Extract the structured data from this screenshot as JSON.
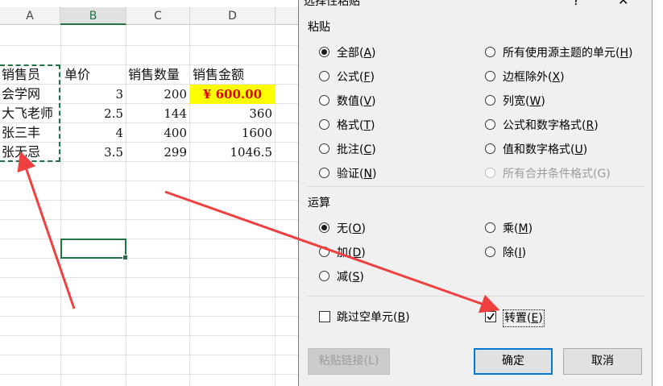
{
  "sheet": {
    "columns": [
      "A",
      "B",
      "C",
      "D"
    ],
    "selected_column": "B",
    "headers": [
      "销售员",
      "单价",
      "销售数量",
      "销售金额"
    ],
    "rows": [
      {
        "name": "会学网",
        "price": "3",
        "qty": "200",
        "amount": "¥ 600.00"
      },
      {
        "name": "大飞老师",
        "price": "2.5",
        "qty": "144",
        "amount": "360"
      },
      {
        "name": "张三丰",
        "price": "4",
        "qty": "400",
        "amount": "1600"
      },
      {
        "name": "张无忌",
        "price": "3.5",
        "qty": "299",
        "amount": "1046.5"
      }
    ]
  },
  "dialog": {
    "title": "选择性粘贴",
    "close_glyph": "✕",
    "min_glyph": "?",
    "paste_group": "粘贴",
    "paste_options_left": [
      {
        "label": "全部",
        "key": "A",
        "checked": true
      },
      {
        "label": "公式",
        "key": "F"
      },
      {
        "label": "数值",
        "key": "V"
      },
      {
        "label": "格式",
        "key": "T"
      },
      {
        "label": "批注",
        "key": "C"
      },
      {
        "label": "验证",
        "key": "N"
      }
    ],
    "paste_options_right": [
      {
        "label": "所有使用源主题的单元",
        "key": "H"
      },
      {
        "label": "边框除外",
        "key": "X"
      },
      {
        "label": "列宽",
        "key": "W"
      },
      {
        "label": "公式和数字格式",
        "key": "R"
      },
      {
        "label": "值和数字格式",
        "key": "U"
      },
      {
        "label": "所有合并条件格式(G)",
        "disabled": true
      }
    ],
    "operation_group": "运算",
    "op_left": [
      {
        "label": "无",
        "key": "O",
        "checked": true
      },
      {
        "label": "加",
        "key": "D"
      },
      {
        "label": "减",
        "key": "S"
      }
    ],
    "op_right": [
      {
        "label": "乘",
        "key": "M"
      },
      {
        "label": "除",
        "key": "I"
      }
    ],
    "skip_blanks": {
      "label": "跳过空单元",
      "key": "B",
      "checked": false
    },
    "transpose": {
      "label": "转置",
      "key": "E",
      "checked": true
    },
    "paste_link_button": "粘贴链接(L)",
    "ok_button": "确定",
    "cancel_button": "取消"
  },
  "colors": {
    "excel_green": "#217346",
    "arrow_red": "#f04040",
    "highlight_yellow": "#ffff00",
    "currency_red": "#e00000"
  }
}
